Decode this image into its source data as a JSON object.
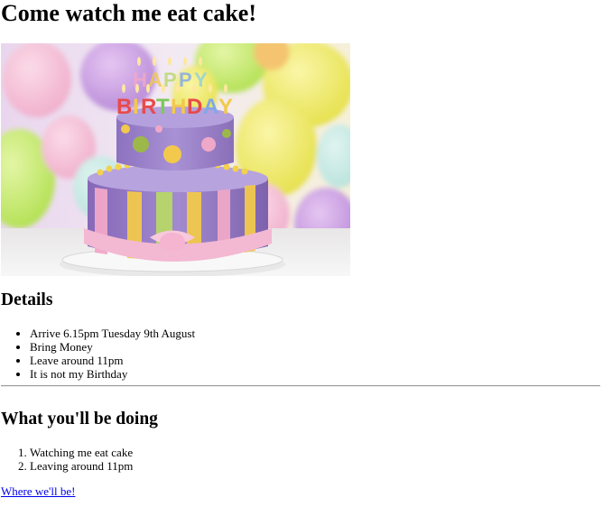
{
  "page": {
    "title": "Come watch me eat cake!",
    "hero_image_alt": "HAPPY BIRTHDAY"
  },
  "details": {
    "heading": "Details",
    "items": [
      "Arrive 6.15pm Tuesday 9th August",
      "Bring Money",
      "Leave around 11pm",
      "It is not my Birthday"
    ]
  },
  "doing": {
    "heading": "What you'll be doing",
    "items": [
      "Watching me eat cake",
      "Leaving around 11pm"
    ]
  },
  "link": {
    "label": "Where we'll be!",
    "color": "#0000ee"
  }
}
